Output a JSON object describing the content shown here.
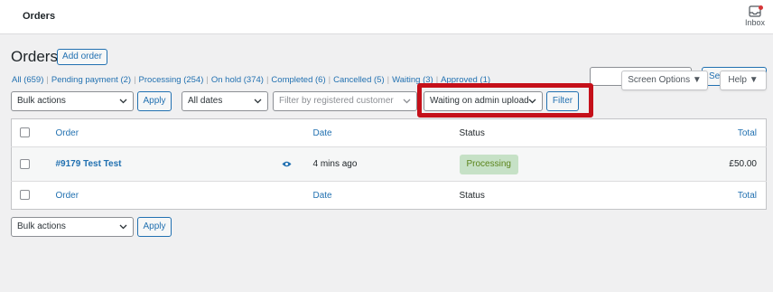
{
  "header": {
    "title": "Orders",
    "inbox_label": "Inbox"
  },
  "page": {
    "title": "Orders",
    "add_order_label": "Add order"
  },
  "filters": [
    {
      "label": "All",
      "count": "(659)"
    },
    {
      "label": "Pending payment",
      "count": "(2)"
    },
    {
      "label": "Processing",
      "count": "(254)"
    },
    {
      "label": "On hold",
      "count": "(374)"
    },
    {
      "label": "Completed",
      "count": "(6)"
    },
    {
      "label": "Cancelled",
      "count": "(5)"
    },
    {
      "label": "Waiting",
      "count": "(3)"
    },
    {
      "label": "Approved",
      "count": "(1)"
    }
  ],
  "top_right": {
    "search_label": "Sea",
    "screen_options_label": "Screen Options ▼",
    "help_label": "Help ▼"
  },
  "toolbar": {
    "bulk_actions": "Bulk actions",
    "apply_label": "Apply",
    "dates": "All dates",
    "customer_placeholder": "Filter by registered customer",
    "status_filter": "Waiting on admin upload",
    "filter_label": "Filter"
  },
  "table": {
    "columns": {
      "order": "Order",
      "date": "Date",
      "status": "Status",
      "total": "Total"
    },
    "rows": [
      {
        "order": "#9179 Test Test",
        "date": "4 mins ago",
        "status": "Processing",
        "total": "£50.00"
      }
    ]
  },
  "bottom_toolbar": {
    "bulk_actions": "Bulk actions",
    "apply_label": "Apply"
  },
  "colors": {
    "accent": "#2271b1",
    "highlight": "#c5101a",
    "status_processing_bg": "#c6e1c6",
    "status_processing_text": "#5b841b"
  },
  "icons": {
    "inbox": "inbox-icon",
    "preview": "eye-icon",
    "dropdown": "chevron-down-icon"
  }
}
